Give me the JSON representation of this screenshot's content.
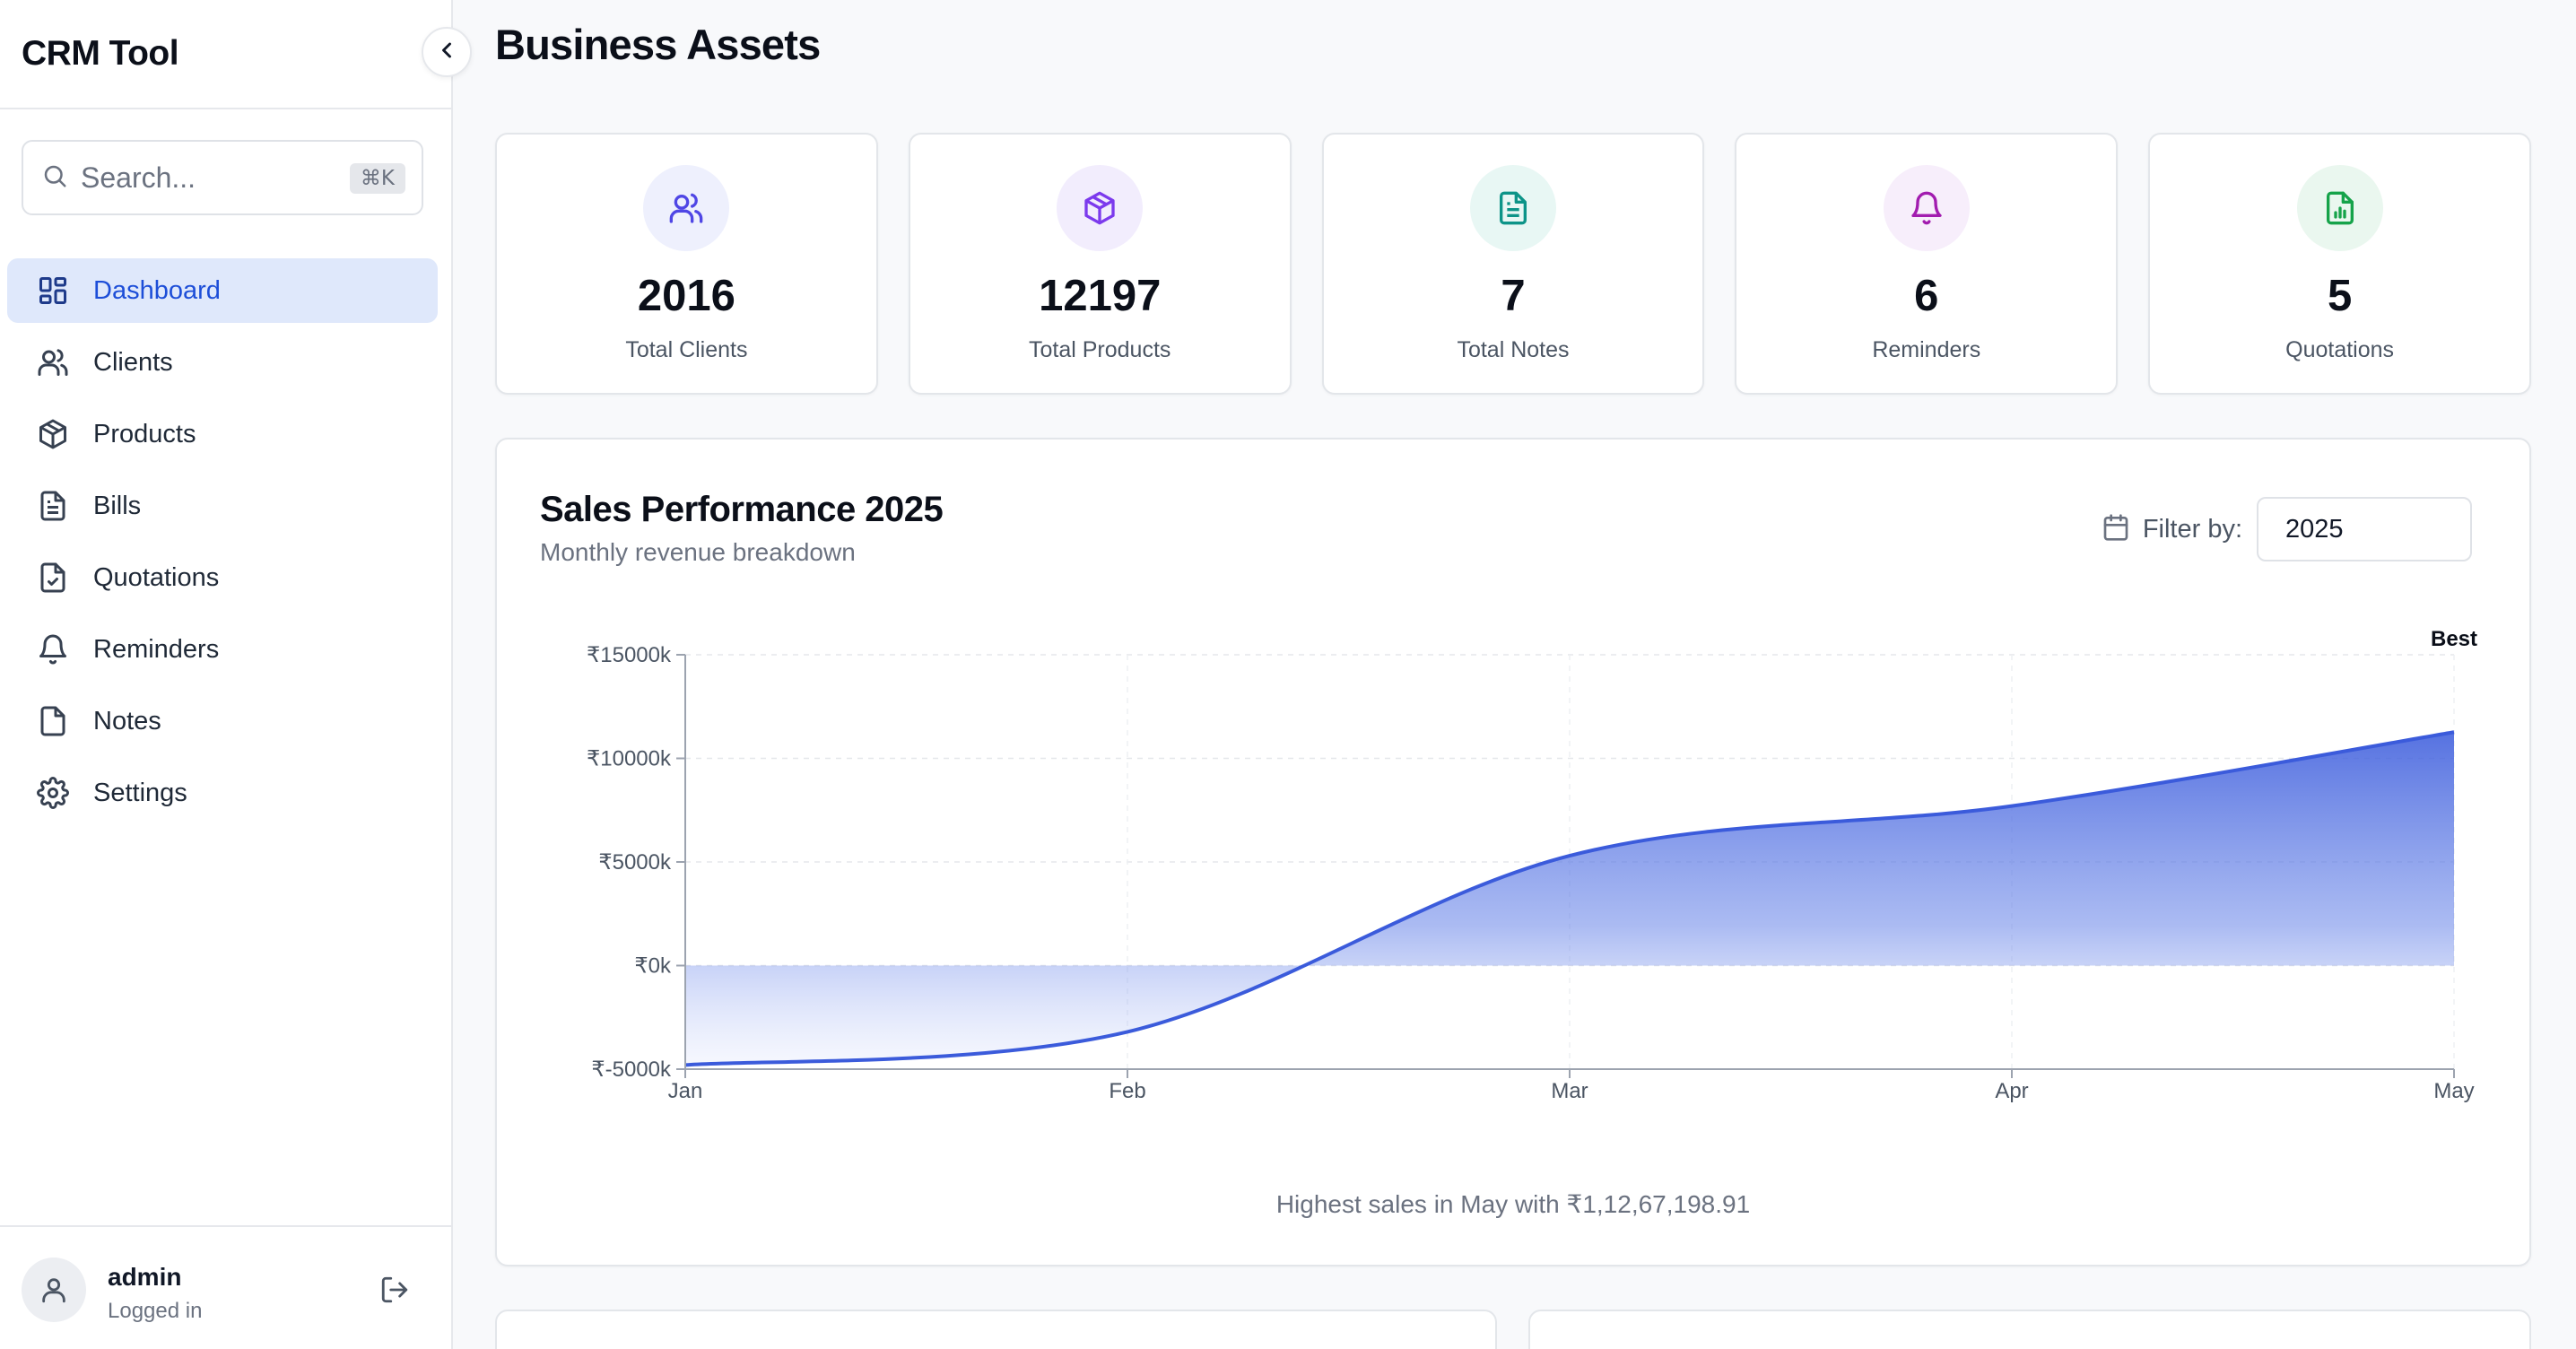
{
  "app": {
    "title": "CRM Tool"
  },
  "search": {
    "placeholder": "Search...",
    "shortcut": "⌘K"
  },
  "sidebar": {
    "items": [
      {
        "label": "Dashboard",
        "icon": "dashboard-icon",
        "active": true
      },
      {
        "label": "Clients",
        "icon": "users-icon"
      },
      {
        "label": "Products",
        "icon": "box-icon"
      },
      {
        "label": "Bills",
        "icon": "file-text-icon"
      },
      {
        "label": "Quotations",
        "icon": "file-check-icon"
      },
      {
        "label": "Reminders",
        "icon": "bell-icon"
      },
      {
        "label": "Notes",
        "icon": "note-icon"
      },
      {
        "label": "Settings",
        "icon": "gear-icon"
      }
    ]
  },
  "user": {
    "name": "admin",
    "status": "Logged in"
  },
  "page": {
    "title": "Business Assets"
  },
  "stats": [
    {
      "value": "2016",
      "label": "Total Clients",
      "icon": "users-icon",
      "color": "#4f46e5",
      "bg": "#eef0fd"
    },
    {
      "value": "12197",
      "label": "Total Products",
      "icon": "box-icon",
      "color": "#7c3aed",
      "bg": "#f2edfd"
    },
    {
      "value": "7",
      "label": "Total Notes",
      "icon": "file-text-icon",
      "color": "#0d9488",
      "bg": "#e8f7f4"
    },
    {
      "value": "6",
      "label": "Reminders",
      "icon": "bell-icon",
      "color": "#a21caf",
      "bg": "#f7eefb"
    },
    {
      "value": "5",
      "label": "Quotations",
      "icon": "file-chart-icon",
      "color": "#16a34a",
      "bg": "#eaf7ef"
    }
  ],
  "chart": {
    "title": "Sales Performance 2025",
    "subtitle": "Monthly revenue breakdown",
    "filter_label": "Filter by:",
    "filter_value": "2025",
    "caption": "Highest sales in May with ₹1,12,67,198.91"
  },
  "chart_data": {
    "type": "area",
    "categories": [
      "Jan",
      "Feb",
      "Mar",
      "Apr",
      "May"
    ],
    "series": [
      {
        "values": [
          -4800,
          -3200,
          5300,
          7700,
          11267
        ]
      }
    ],
    "yticks": [
      "₹15000k",
      "₹10000k",
      "₹5000k",
      "₹0k",
      "₹-5000k"
    ],
    "ylim": [
      -5000,
      15000
    ],
    "annotation": "Best",
    "color": "#3b5bdb",
    "grid": true
  }
}
